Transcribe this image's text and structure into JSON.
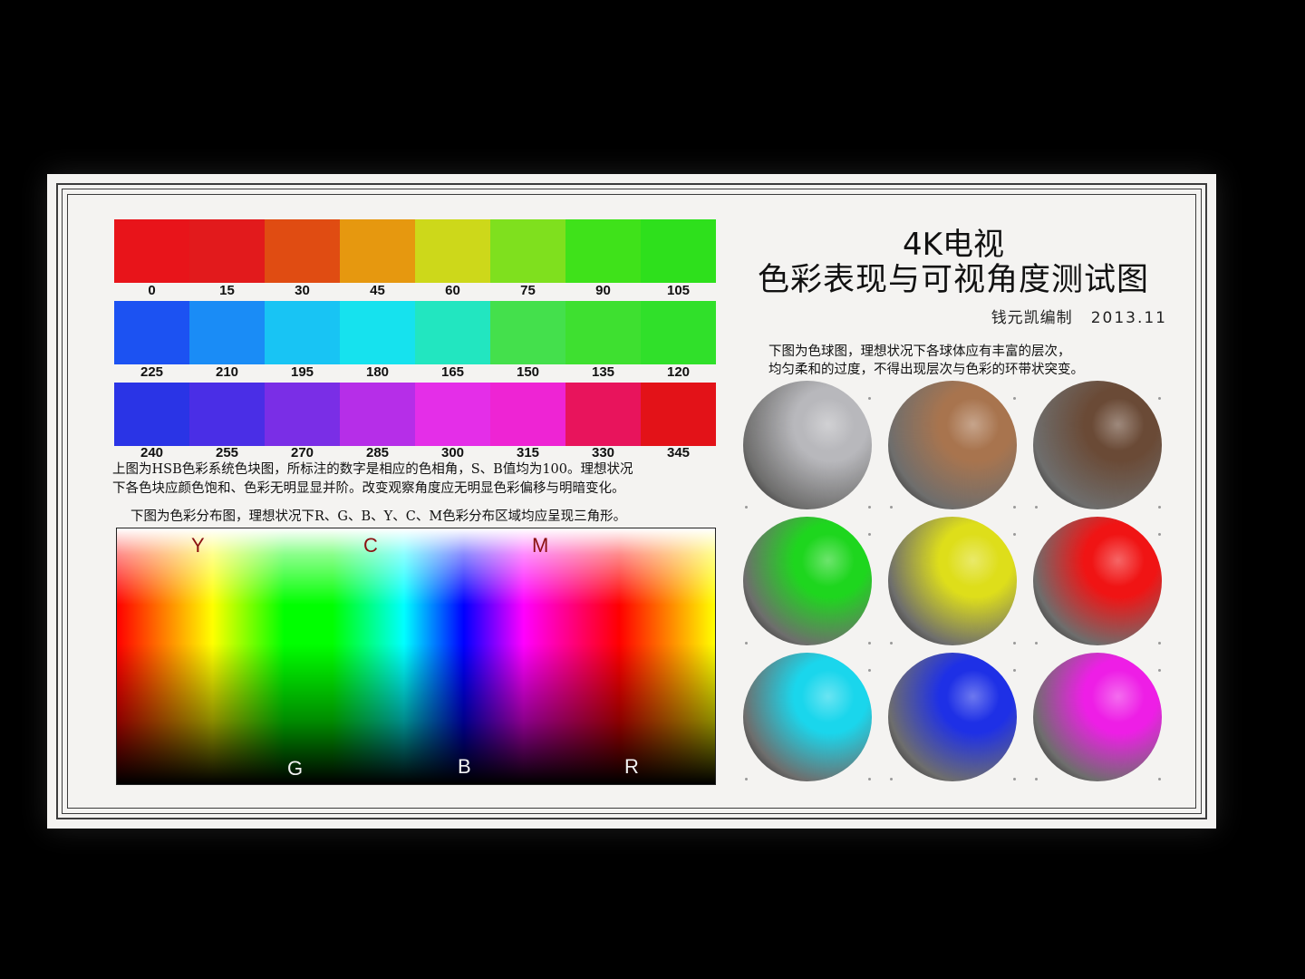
{
  "hsb_chart": {
    "rows": [
      {
        "hues": [
          0,
          15,
          30,
          45,
          60,
          75,
          90,
          105
        ],
        "colors": [
          "#e8141a",
          "#e21a1c",
          "#e04c12",
          "#e6980f",
          "#cdd81a",
          "#7fe01e",
          "#3fe21a",
          "#2ee01c"
        ]
      },
      {
        "hues": [
          225,
          210,
          195,
          180,
          165,
          150,
          135,
          120
        ],
        "colors": [
          "#1c52f2",
          "#1a8cf6",
          "#18c4f4",
          "#16e2ee",
          "#22e6c0",
          "#44e04c",
          "#3ee030",
          "#30e02a"
        ]
      },
      {
        "hues": [
          240,
          255,
          270,
          285,
          300,
          315,
          330,
          345
        ],
        "colors": [
          "#2a34e6",
          "#4a2ee6",
          "#7a2ee6",
          "#b62ee8",
          "#e42ee8",
          "#ee24d4",
          "#e8145c",
          "#e31218"
        ]
      }
    ],
    "description_1": "上图为HSB色彩系统色块图，所标注的数字是相应的色相角，S、B值均为100。理想状况",
    "description_2": "下各色块应颜色饱和、色彩无明显显并阶。改变观察角度应无明显色彩偏移与明暗变化。"
  },
  "distribution": {
    "caption": "下图为色彩分布图，理想状况下R、G、B、Y、C、M色彩分布区域均应呈现三角形。",
    "top_labels": [
      "Y",
      "C",
      "M"
    ],
    "bottom_labels": [
      "G",
      "B",
      "R"
    ],
    "top_label_color": "#8b1010",
    "bottom_label_color": "#f2f2f2"
  },
  "header": {
    "title_line1": "4K电视",
    "title_line2": "色彩表现与可视角度测试图",
    "author": "钱元凯编制",
    "date": "2013.11"
  },
  "spheres": {
    "caption_1": "下图为色球图，理想状况下各球体应有丰富的层次，",
    "caption_2": "均匀柔和的过度，不得出现层次与色彩的环带状突变。",
    "items": [
      {
        "name": "gray",
        "color": "#b8b8bc"
      },
      {
        "name": "brown",
        "color": "#a8744e"
      },
      {
        "name": "dark-brown",
        "color": "#6a4a36"
      },
      {
        "name": "green",
        "color": "#1ed61e"
      },
      {
        "name": "yellow",
        "color": "#dede1a"
      },
      {
        "name": "red",
        "color": "#f01414"
      },
      {
        "name": "cyan",
        "color": "#1ad6ec"
      },
      {
        "name": "blue",
        "color": "#1e30e6"
      },
      {
        "name": "magenta",
        "color": "#ee1ee6"
      }
    ]
  }
}
